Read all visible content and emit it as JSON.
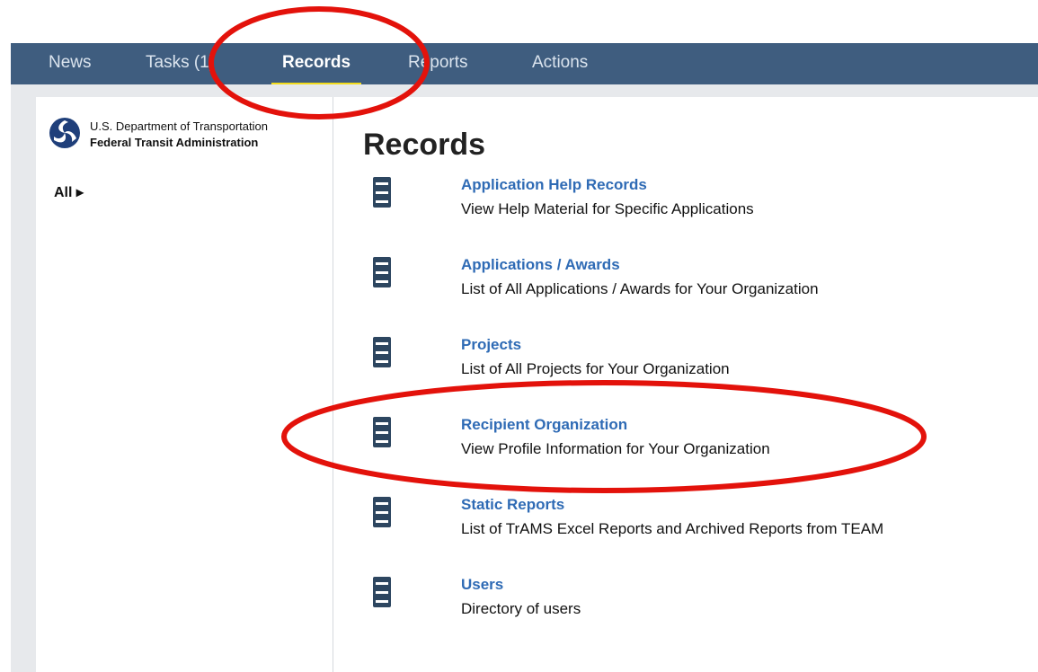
{
  "nav": {
    "tabs": [
      {
        "label": "News"
      },
      {
        "label": "Tasks (1)"
      },
      {
        "label": "Records"
      },
      {
        "label": "Reports"
      },
      {
        "label": "Actions"
      }
    ],
    "active": "Records"
  },
  "sidebar": {
    "logo": {
      "line1": "U.S. Department of Transportation",
      "line2": "Federal Transit Administration"
    },
    "all_label": "All ▸"
  },
  "main": {
    "title": "Records",
    "items": [
      {
        "title": "Application Help Records",
        "desc": "View Help Material for Specific Applications",
        "icon": "file-cabinet-icon"
      },
      {
        "title": "Applications / Awards",
        "desc": "List of All Applications / Awards for Your Organization",
        "icon": "file-cabinet-icon"
      },
      {
        "title": "Projects",
        "desc": "List of All Projects for Your Organization",
        "icon": "file-cabinet-icon"
      },
      {
        "title": "Recipient Organization",
        "desc": "View Profile Information for Your Organization",
        "icon": "file-cabinet-icon"
      },
      {
        "title": "Static Reports",
        "desc": "List of TrAMS Excel Reports and Archived Reports from TEAM",
        "icon": "file-cabinet-icon"
      },
      {
        "title": "Users",
        "desc": "Directory of users",
        "icon": "file-cabinet-icon"
      }
    ]
  },
  "colors": {
    "navbar": "#3f5d7f",
    "active_underline": "#f3dc1d",
    "link": "#2f6bb5",
    "annotation": "#e3120b"
  }
}
